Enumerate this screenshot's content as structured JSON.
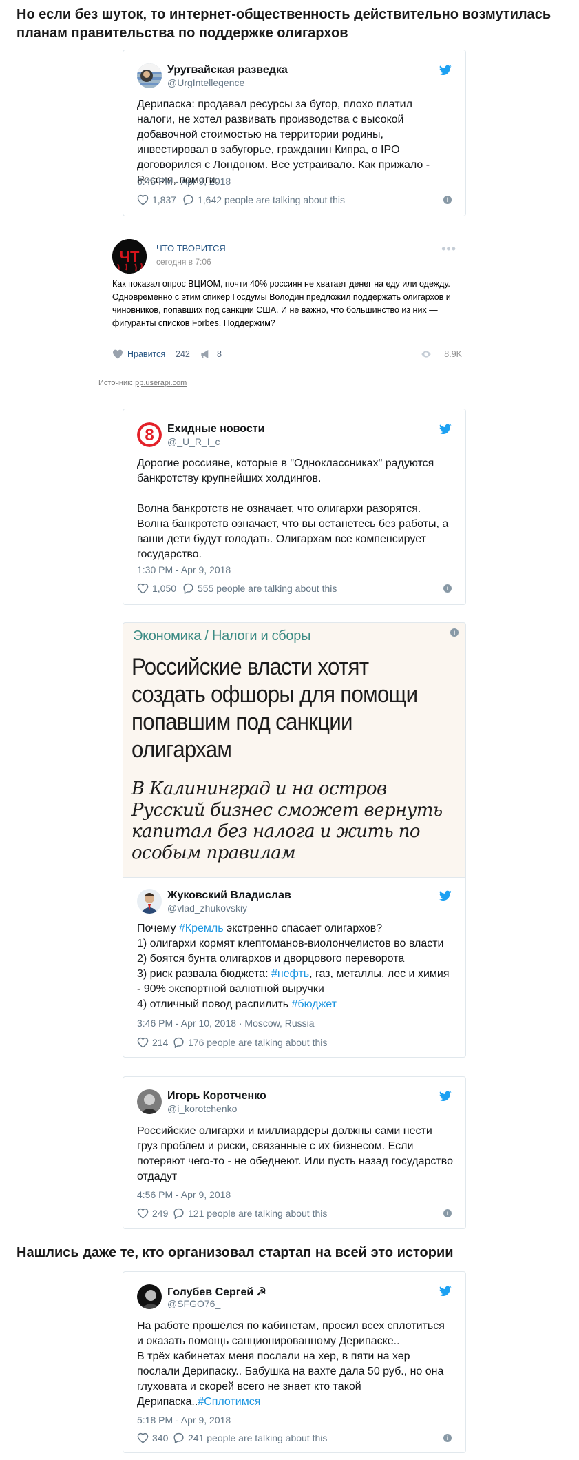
{
  "headings": {
    "intro": "Но если без шуток, то интернет-общественность действительно возмутилась планам правительства по поддержке олигархов",
    "startup": "Нашлись даже те, кто организовал стартап на всей это истории"
  },
  "tweets": [
    {
      "name": "Уругвайская разведка",
      "handle": "@UrgIntellegence",
      "text": "Дерипаска: продавал ресурсы за бугор, плохо платил налоги, не хотел развивать производства с высокой добавочной стоимостью на территории родины, инвестировал в забугорье, гражданин Кипра, о IPO договорился с Лондоном. Все устраивало. Как прижало - Россия, помоги..",
      "time": "6:45 PM - Apr 9, 2018",
      "likes": "1,837",
      "talking": "1,642 people are talking about this"
    },
    {
      "name": "Ехидные новости",
      "handle": "@_U_R_I_c",
      "text": "Дорогие россияне, которые в \"Одноклассниках\" радуются банкротству крупнейших холдингов.\n\nВолна банкротств не означает, что олигархи разорятся. Волна банкротств означает, что вы останетесь без работы, а ваши дети будут голодать. Олигархам все компенсирует государство.",
      "time": "1:30 PM - Apr 9, 2018",
      "likes": "1,050",
      "talking": "555 people are talking about this"
    },
    {
      "name": "Жуковский Владислав",
      "handle": "@vlad_zhukovskiy",
      "text_parts": [
        "Почему ",
        "#Кремль",
        " экстренно спасает олигархов?\n1) олигархи кормят клептоманов-виолончелистов во власти\n2) боятся бунта олигархов и дворцового переворота\n3) риск развала бюджета: ",
        "#нефть",
        ", газ, металлы, лес и химия - 90% экспортной валютной выручки\n4) отличный повод распилить ",
        "#бюджет"
      ],
      "time": "3:46 PM - Apr 10, 2018",
      "location": " · Moscow, Russia",
      "likes": "214",
      "talking": "176 people are talking about this"
    },
    {
      "name": "Игорь Коротченко",
      "handle": "@i_korotchenko",
      "text": "Российские олигархи  и миллиардеры должны сами нести груз проблем и риски, связанные с их бизнесом. Если потеряют чего-то - не обеднеют. Или пусть назад государство отдадут",
      "time": "4:56 PM - Apr 9, 2018",
      "likes": "249",
      "talking": "121 people are talking about this"
    },
    {
      "name": "Голубев Сергей ☭",
      "handle": "@SFGO76_",
      "text_parts": [
        "На работе прошёлся по кабинетам, просил всех сплотиться и оказать помощь санционированному Дерипаске..\nВ трёх кабинетах меня послали на хер, в пяти на хер послали Дерипаску.. Бабушка на вахте дала 50 руб., но она глуховата и скорей всего не знает кто такой Дерипаска..",
        "#Сплотимся"
      ],
      "time": "5:18 PM - Apr 9, 2018",
      "likes": "340",
      "talking": "241 people are talking about this"
    }
  ],
  "vk": {
    "name": "ЧТО ТВОРИТСЯ",
    "avatar_text": "ЧТ",
    "date": "сегодня в 7:06",
    "dots": "•••",
    "text": "Как показал опрос ВЦИОМ, почти 40% россиян не хватает денег на еду или одежду. Одновременно с этим спикер Госдумы Володин предложил поддержать олигархов и чиновников, попавших под санкции США. И не важно, что большинство из них — фигуранты списков Forbes. Поддержим?",
    "like_label": "Нравится",
    "likes": "242",
    "shares": "8",
    "views": "8.9K"
  },
  "source": {
    "label": "Источник: ",
    "link": "pp.userapi.com"
  },
  "article": {
    "rubric": "Экономика / Налоги и сборы",
    "title": "Российские власти хотят создать офшоры для помощи попавшим под санкции олигархам",
    "subtitle": "В Калининград и на остров Русский бизнес сможет вернуть капитал без налога и жить по особым правилам"
  },
  "icons": {
    "bird": "twitter-bird-icon",
    "heart": "heart-icon",
    "bubble": "reply-bubble-icon",
    "info": "info-icon"
  },
  "colors": {
    "twitter_blue": "#1da1f2",
    "hashtag": "#1b95e0",
    "vk_link": "#2a5885",
    "rubric": "#3c8b84"
  }
}
